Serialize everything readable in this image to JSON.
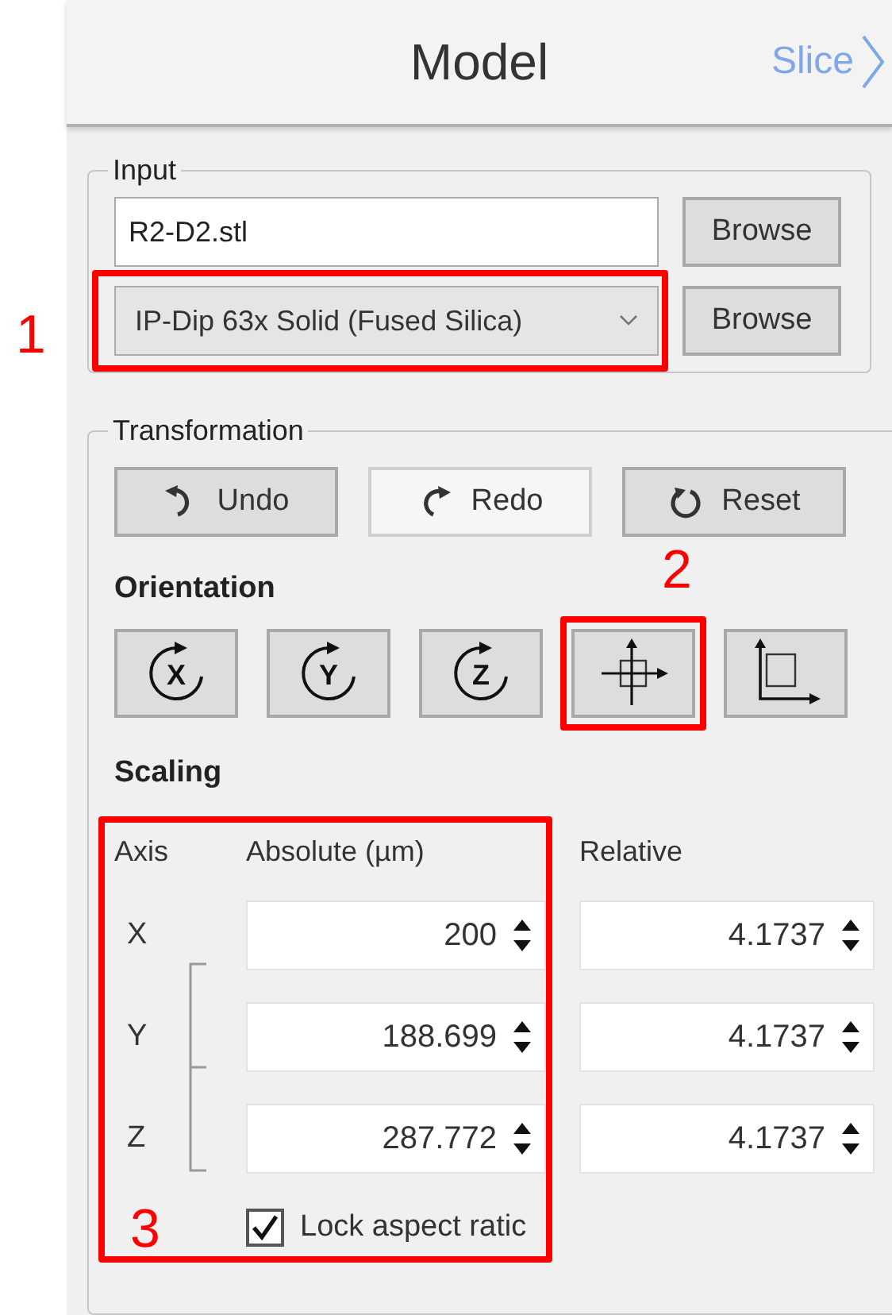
{
  "header": {
    "title": "Model",
    "next_link": "Slice"
  },
  "input": {
    "title": "Input",
    "file_field": {
      "value": "R2-D2.stl"
    },
    "file_browse": "Browse",
    "material_dropdown": {
      "value": "IP-Dip 63x Solid (Fused Silica)"
    },
    "material_browse": "Browse"
  },
  "transformation": {
    "title": "Transformation",
    "history_buttons": [
      {
        "label": "Undo",
        "kind": "undo",
        "highlighted": false
      },
      {
        "label": "Redo",
        "kind": "redo",
        "highlighted": true
      },
      {
        "label": "Reset",
        "kind": "reset",
        "highlighted": false
      }
    ],
    "orientation": {
      "title": "Orientation",
      "buttons": [
        {
          "kind": "rotate",
          "symbol": "X"
        },
        {
          "kind": "rotate",
          "symbol": "Y"
        },
        {
          "kind": "rotate",
          "symbol": "Z"
        },
        {
          "kind": "center"
        },
        {
          "kind": "align"
        }
      ]
    },
    "scaling": {
      "title": "Scaling",
      "columns": [
        "Axis",
        "Absolute (µm)",
        "Relative"
      ],
      "rows": [
        {
          "axis": "X",
          "absolute": "200",
          "relative": "4.1737"
        },
        {
          "axis": "Y",
          "absolute": "188.699",
          "relative": "4.1737"
        },
        {
          "axis": "Z",
          "absolute": "287.772",
          "relative": "4.1737"
        }
      ],
      "lock": {
        "label": "Lock aspect ratic",
        "checked": true
      }
    }
  },
  "annotations": [
    {
      "label": "1"
    },
    {
      "label": "2"
    },
    {
      "label": "3"
    }
  ]
}
